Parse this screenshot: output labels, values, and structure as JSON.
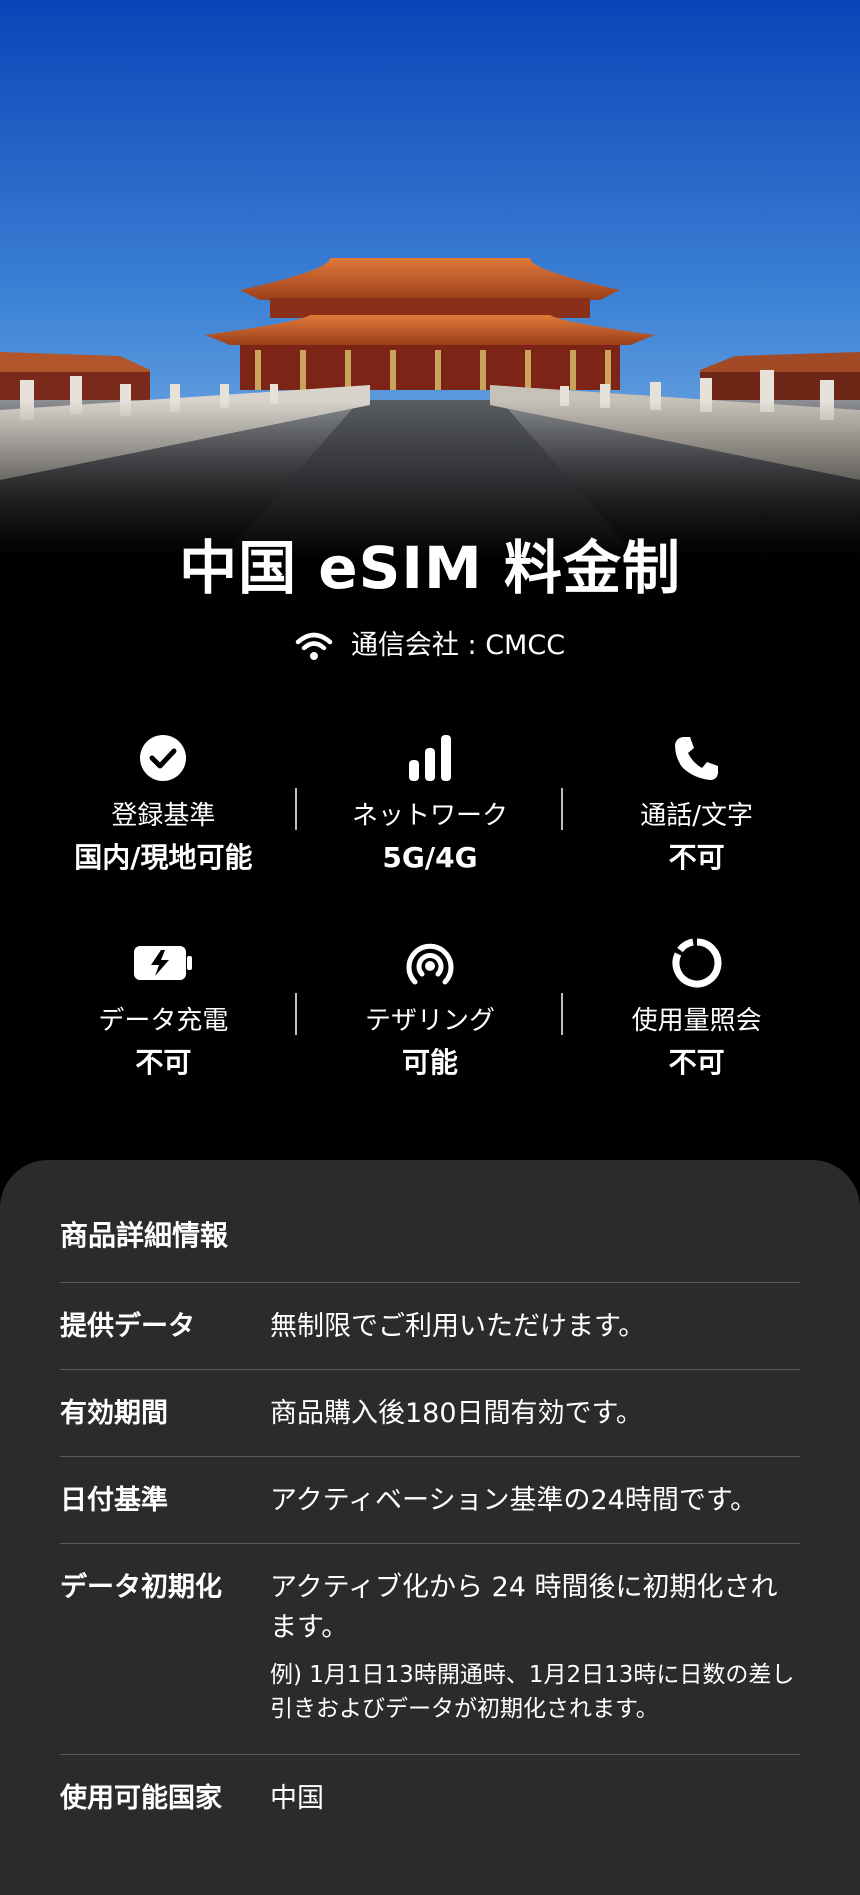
{
  "title": "中国 eSIM 料金制",
  "carrier": {
    "icon": "wifi-icon",
    "label": "通信会社 : CMCC"
  },
  "features": [
    {
      "icon": "check-circle-icon",
      "label": "登録基準",
      "value": "国内/現地可能"
    },
    {
      "icon": "signal-bars-icon",
      "label": "ネットワーク",
      "value": "5G/4G"
    },
    {
      "icon": "phone-icon",
      "label": "通話/文字",
      "value": "不可"
    },
    {
      "icon": "battery-charge-icon",
      "label": "データ充電",
      "value": "不可"
    },
    {
      "icon": "hotspot-icon",
      "label": "テザリング",
      "value": "可能"
    },
    {
      "icon": "usage-ring-icon",
      "label": "使用量照会",
      "value": "不可"
    }
  ],
  "details": {
    "title": "商品詳細情報",
    "rows": [
      {
        "label": "提供データ",
        "value": "無制限でご利用いただけます。"
      },
      {
        "label": "有効期間",
        "value": "商品購入後180日間有効です。"
      },
      {
        "label": "日付基準",
        "value": "アクティベーション基準の24時間です。"
      },
      {
        "label": "データ初期化",
        "value": "アクティブ化から 24 時間後に初期化されます。",
        "note": "例) 1月1日13時開通時、1月2日13時に日数の差し引きおよびデータが初期化されます。"
      },
      {
        "label": "使用可能国家",
        "value": "中国"
      }
    ]
  },
  "colors": {
    "background": "#000000",
    "panel": "#2b2b2b",
    "sky_top": "#0d4fc4",
    "sky_bottom": "#7fb3e6"
  }
}
